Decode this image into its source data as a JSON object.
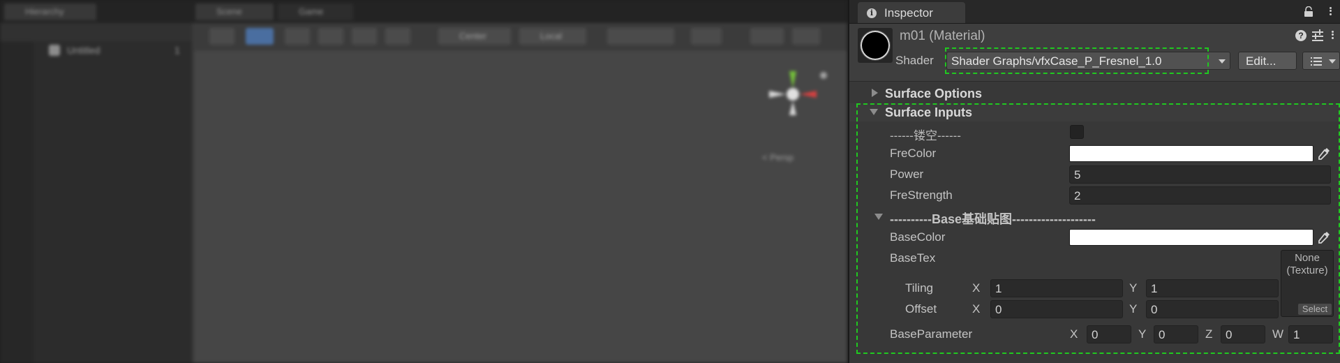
{
  "editor": {
    "hierarchy_tab": "Hierarchy",
    "scene_tab": "Scene",
    "game_tab": "Game",
    "scene_root": "Untitled",
    "scene_root_count": "1",
    "center_label": "Center",
    "local_label": "Local",
    "gizmo_label": "< Persp"
  },
  "inspector": {
    "tab_label": "Inspector",
    "material_name": "m01 (Material)",
    "shader_label": "Shader",
    "shader_value": "Shader Graphs/vfxCase_P_Fresnel_1.0",
    "edit_button": "Edit...",
    "sections": {
      "surface_options": "Surface Options",
      "surface_inputs": "Surface Inputs"
    },
    "props": {
      "hollow_header": "------镂空------",
      "fre_color_label": "FreColor",
      "power_label": "Power",
      "power_value": "5",
      "fre_strength_label": "FreStrength",
      "fre_strength_value": "2",
      "base_header": "----------Base基础贴图--------------------",
      "base_color_label": "BaseColor",
      "base_tex_label": "BaseTex",
      "tex_none": "None",
      "tex_type": "(Texture)",
      "tex_select": "Select",
      "tiling_label": "Tiling",
      "tiling_x": "1",
      "tiling_y": "1",
      "offset_label": "Offset",
      "offset_x": "0",
      "offset_y": "0",
      "base_param_label": "BaseParameter",
      "base_param_x": "0",
      "base_param_y": "0",
      "base_param_z": "0",
      "base_param_w": "1",
      "axis_x": "X",
      "axis_y": "Y",
      "axis_z": "Z",
      "axis_w": "W"
    }
  },
  "colors": {
    "highlight": "#20c820",
    "fre_color": "#ffffff",
    "base_color": "#ffffff"
  }
}
